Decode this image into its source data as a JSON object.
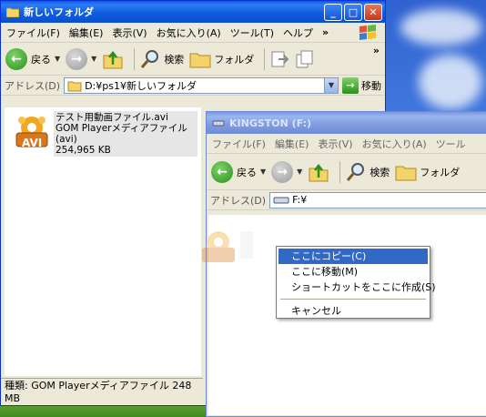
{
  "window1": {
    "title": "新しいフォルダ",
    "menu": [
      "ファイル(F)",
      "編集(E)",
      "表示(V)",
      "お気に入り(A)",
      "ツール(T)",
      "ヘルプ"
    ],
    "menu_more": "»",
    "toolbar": {
      "back": "戻る",
      "search": "検索",
      "folders": "フォルダ",
      "more": "»"
    },
    "address_label": "アドレス(D)",
    "address_value": "D:¥ps1¥新しいフォルダ",
    "go_label": "移動",
    "file": {
      "name": "テスト用動画ファイル.avi",
      "type": "GOM Playerメディアファイル(avi)",
      "size": "254,965 KB",
      "icon_text": "AVI"
    },
    "status": "種類: GOM Playerメディアファイル 248 MB"
  },
  "window2": {
    "title": "KINGSTON (F:)",
    "menu": [
      "ファイル(F)",
      "編集(E)",
      "表示(V)",
      "お気に入り(A)",
      "ツール"
    ],
    "toolbar": {
      "back": "戻る",
      "search": "検索",
      "folders": "フォルダ"
    },
    "address_label": "アドレス(D)",
    "address_value": "F:¥"
  },
  "context_menu": {
    "items": [
      "ここにコピー(C)",
      "ここに移動(M)",
      "ショートカットをここに作成(S)"
    ],
    "cancel": "キャンセル"
  },
  "colors": {
    "selection": "#316ac5",
    "title_active": "#0a5ddf",
    "window_bg": "#ece9d8"
  }
}
